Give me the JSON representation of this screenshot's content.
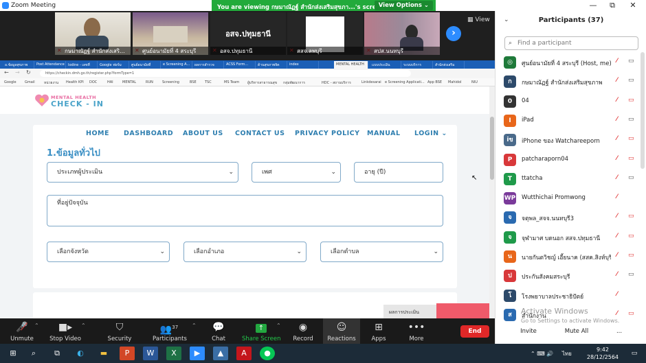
{
  "window": {
    "title": "Zoom Meeting",
    "minimize": "—",
    "maximize": "⧉",
    "close": "✕"
  },
  "banner": {
    "text": "You are viewing กษมาณัฏฐ์ สำนักส่งเสริมสุขภา...'s screen",
    "view_options": "View Options ⌄"
  },
  "thumbnails": [
    {
      "name": "กษมาณัฏฐ์ สำนักส่งเสริ..."
    },
    {
      "name": "ศูนย์อนามัยที่ 4 สระบุรี"
    },
    {
      "name": "อสจ.ปทุมธานี",
      "center_text": "อสจ.ปทุมธานี"
    },
    {
      "name": "สสจ.ลพบุรี"
    },
    {
      "name": "สปส.นนทบุรี"
    }
  ],
  "view_label": "View",
  "browser": {
    "tabs": [
      "อ.ข้อมูลสุขภาพ",
      "Post Attendance",
      "Iodine - เลขที่",
      "Google ฟอร์ม",
      "ศูนย์อนามัยที่",
      "e Screening A...",
      "ผลการสำรวจ",
      "ACSS Form...",
      "ด้านสุขภาพจิต",
      "index",
      "MENTAL HEALTH",
      "แบบประเมิน",
      "ระบบบริการ",
      "สำนักส่งเสริม"
    ],
    "url": "https://checkin.dmh.go.th/register.php?formType=1",
    "bookmarks": [
      "Google",
      "Gmail",
      "หน่วยงาน",
      "Health KPI",
      "DOC",
      "HAI",
      "MENTAL",
      "RUN",
      "Screening",
      "BSE",
      "TSC",
      "MS Team",
      "ผู้บริหารสาธารณสุข",
      "กลุ่มพัฒนาการ",
      "HDC - สถานบริการ",
      "Linkdesarai",
      "e Screening Applicati...",
      "App BSE",
      "Mahidol",
      "NIU"
    ]
  },
  "site": {
    "logo_line1": "MENTAL HEALTH",
    "logo_line2": "CHECK - IN",
    "nav": [
      "HOME",
      "DASHBOARD",
      "ABOUT US",
      "CONTACT US",
      "PRIVACY POLICY",
      "MANUAL",
      "LOGIN ⌄"
    ],
    "section_title": "1.ข้อมูลทั่วไป",
    "fields": {
      "evaluator_type": "ประเภทผู้ประเมิน",
      "gender": "เพศ",
      "age": "อายุ (ปี)",
      "address": "ที่อยู่ปัจจุบัน",
      "province": "เลือกจังหวัด",
      "district": "เลือกอำเภอ",
      "subdistrict": "เลือกตำบล"
    },
    "bottom_button": "ผลการประเมิน"
  },
  "toolbar": {
    "unmute": "Unmute",
    "stop_video": "Stop Video",
    "security": "Security",
    "participants": "Participants",
    "participants_count": "37",
    "chat": "Chat",
    "share_screen": "Share Screen",
    "record": "Record",
    "reactions": "Reactions",
    "apps": "Apps",
    "more": "More",
    "end": "End"
  },
  "participants_panel": {
    "title": "Participants (37)",
    "search_placeholder": "Find a participant",
    "list": [
      {
        "initial": "◎",
        "color": "#1f7a3a",
        "name": "ศูนย์อนามัยที่ 4 สระบุรี (Host, me)",
        "mic": "🎤",
        "video": "▭",
        "video_off": false
      },
      {
        "initial": "ก",
        "color": "#2d4a6a",
        "name": "กษมาณัฏฐ์ สำนักส่งเสริมสุขภาพ",
        "mic": "🎤",
        "video": "▭",
        "video_off": false
      },
      {
        "initial": "0",
        "color": "#333333",
        "name": "04",
        "mic": "🎤",
        "video": "▭",
        "video_off": true
      },
      {
        "initial": "I",
        "color": "#e8661a",
        "name": "iPad",
        "mic": "🎤",
        "video": "▭",
        "video_off": false
      },
      {
        "initial": "iข",
        "color": "#4a6a8a",
        "name": "iPhone ของ Watchareeporn",
        "mic": "🎤",
        "video": "▭",
        "video_off": true
      },
      {
        "initial": "P",
        "color": "#d8383a",
        "name": "patcharaporn04",
        "mic": "🎤",
        "video": "▭",
        "video_off": true
      },
      {
        "initial": "T",
        "color": "#1f9a4a",
        "name": "ttatcha",
        "mic": "🎤",
        "video": "▭",
        "video_off": false
      },
      {
        "initial": "WP",
        "color": "#7a3a9a",
        "name": "Wutthichai Promwong",
        "mic": "🎤",
        "video": "",
        "video_off": false
      },
      {
        "initial": "จ",
        "color": "#2a6ab0",
        "name": "จตุพล_สจจ.นนทบุรี3",
        "mic": "🎤",
        "video": "▭",
        "video_off": true
      },
      {
        "initial": "จ",
        "color": "#1f9a4a",
        "name": "จุฬามาศ บดนอก สสจ.ปทุมธานี",
        "mic": "🎤",
        "video": "▭",
        "video_off": true
      },
      {
        "initial": "น",
        "color": "#e8661a",
        "name": "นายกันตวิชญ์ เอี้ยนาค (สสค.สิงห์บุรี)",
        "mic": "🎤",
        "video": "▭",
        "video_off": true
      },
      {
        "initial": "ป",
        "color": "#d8383a",
        "name": "ประกันสังคมสระบุรี",
        "mic": "🎤",
        "video": "▭",
        "video_off": false
      },
      {
        "initial": "โ",
        "color": "#2d4a6a",
        "name": "โรงพยาบาลประชาธิปัตย์",
        "mic": "🎤",
        "video": "",
        "video_off": false
      },
      {
        "initial": "ส",
        "color": "#2a6ab0",
        "name": "สำนักงาน",
        "mic": "🎤",
        "video": "▭",
        "video_off": true
      }
    ],
    "watermark_title": "Activate Windows",
    "watermark_sub": "Go to Settings to activate Windows.",
    "invite": "Invite",
    "mute_all": "Mute All",
    "more": "..."
  },
  "taskbar": {
    "time": "9:42",
    "date": "28/12/2564",
    "lang": "ไทย",
    "tray": "⌃  ⌨  🔊"
  }
}
